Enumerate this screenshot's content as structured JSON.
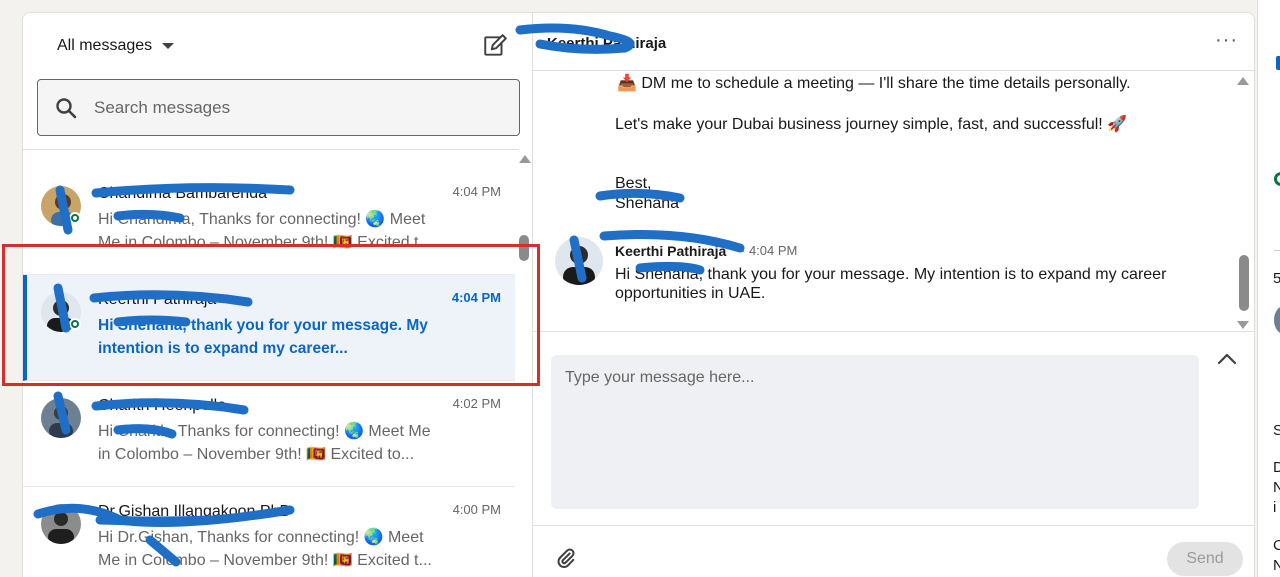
{
  "left_panel": {
    "filter_label": "All messages",
    "search_placeholder": "Search messages",
    "conversations": [
      {
        "name": "Chandima Bambarenda",
        "time": "4:04 PM",
        "snippet": "Hi Chandima, Thanks for connecting! 🌏 Meet Me in Colombo – November 9th! 🇱🇰 Excited t...",
        "active": false,
        "online": true
      },
      {
        "name": "Keerthi Pathiraja",
        "time": "4:04 PM",
        "snippet": "Hi Shehana, thank you for your message. My intention is to expand my career...",
        "active": true,
        "online": true
      },
      {
        "name": "Charith Heenpella",
        "time": "4:02 PM",
        "snippet": "Hi Charith, Thanks for connecting! 🌏 Meet Me in Colombo – November 9th! 🇱🇰 Excited to...",
        "active": false,
        "online": false
      },
      {
        "name": "Dr.Gishan Illangakoon PhD",
        "time": "4:00 PM",
        "snippet": "Hi Dr.Gishan, Thanks for connecting! 🌏 Meet Me in Colombo – November 9th! 🇱🇰 Excited t...",
        "active": false,
        "online": false
      }
    ]
  },
  "right_panel": {
    "header_name": "Keerthi Pathiraja",
    "more_label": "···",
    "messages": {
      "line1": "📥  DM me to schedule a meeting — I'll share the time details personally.",
      "line2": "Let's make your Dubai business journey simple, fast, and successful! 🚀",
      "line3": "Best,",
      "line4": "Shehana"
    },
    "reply": {
      "sender": "Keerthi Pathiraja",
      "time": "· 4:04 PM",
      "text": "Hi Shehana, thank you for your message. My intention is to expand my career opportunities in UAE."
    },
    "compose_placeholder": "Type your message here...",
    "send_label": "Send"
  },
  "side_strip": {
    "fragments": [
      "5",
      "S",
      "D",
      "N",
      "i",
      "C",
      "N"
    ]
  },
  "colors": {
    "accent": "#0a66c2",
    "highlight": "#d32f2f",
    "redaction": "#1f6fc6"
  }
}
